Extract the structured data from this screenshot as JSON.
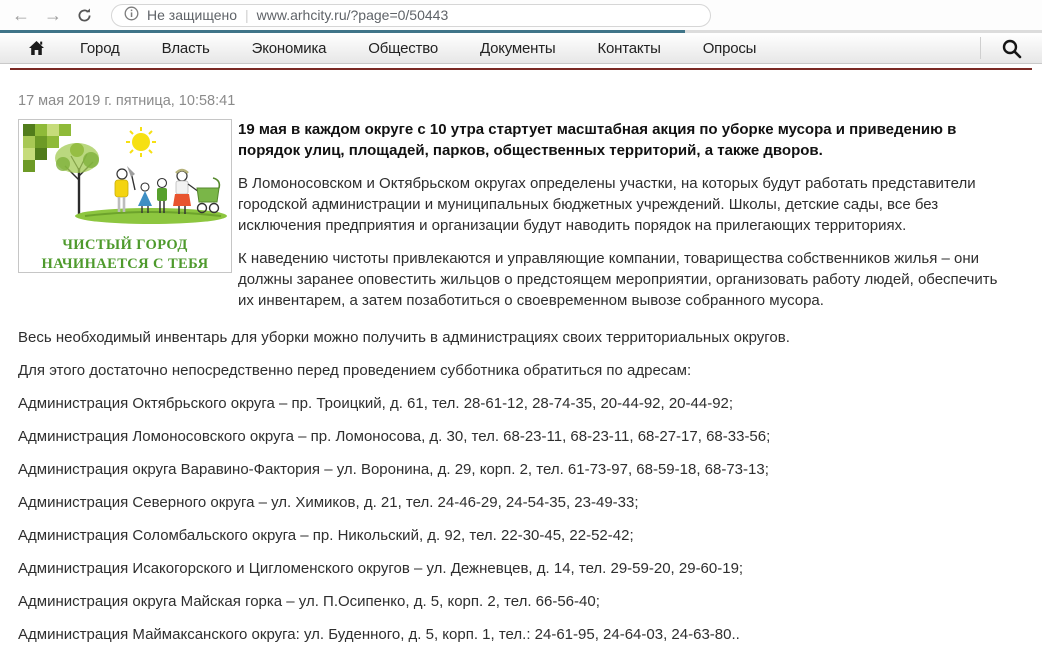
{
  "browser": {
    "back_label": "←",
    "forward_label": "→",
    "security_label": "Не защищено",
    "url": "www.arhcity.ru/?page=0/50443"
  },
  "nav": {
    "items": [
      "Город",
      "Власть",
      "Экономика",
      "Общество",
      "Документы",
      "Контакты",
      "Опросы"
    ]
  },
  "page": {
    "datetime": "17 мая 2019 г. пятница, 10:58:41"
  },
  "article": {
    "poster": {
      "line1": "ЧИСТЫЙ ГОРОД",
      "line2": "НАЧИНАЕТСЯ С ТЕБЯ"
    },
    "lead": "19 мая в каждом округе с 10 утра стартует масштабная акция по уборке мусора и приведению в порядок улиц, площадей, парков, общественных территорий, а также дворов.",
    "side_paragraphs": [
      "В Ломоносовском и Октябрьском округах определены участки, на которых будут работать представители городской администрации и муниципальных бюджетных учреждений. Школы, детские сады, все без исключения предприятия и организации будут наводить порядок на прилегающих территориях.",
      "К наведению чистоты привлекаются и управляющие компании, товарищества собственников жилья – они должны заранее оповестить жильцов о предстоящем мероприятии, организовать работу людей, обеспечить их инвентарем, а затем позаботиться о своевременном вывозе собранного мусора."
    ],
    "full_paragraphs": [
      "Весь необходимый инвентарь для уборки можно получить в администрациях своих территориальных округов.",
      "Для этого достаточно непосредственно перед проведением субботника обратиться по адресам:"
    ],
    "addresses": [
      "Администрация Октябрьского округа – пр. Троицкий, д. 61, тел. 28-61-12, 28-74-35, 20-44-92, 20-44-92;",
      "Администрация Ломоносовского округа – пр. Ломоносова, д. 30, тел. 68-23-11, 68-23-11, 68-27-17, 68-33-56;",
      "Администрация округа Варавино-Фактория – ул. Воронина, д. 29, корп. 2, тел. 61-73-97, 68-59-18, 68-73-13;",
      "Администрация Северного округа – ул. Химиков, д. 21, тел. 24-46-29, 24-54-35, 23-49-33;",
      "Администрация Соломбальского округа – пр. Никольский, д. 92, тел. 22-30-45, 22-52-42;",
      "Администрация Исакогорского и Цигломенского округов – ул. Дежневцев, д. 14, тел. 29-59-20, 29-60-19;",
      "Администрация округа Майская горка – ул. П.Осипенко, д. 5, корп. 2, тел. 66-56-40;",
      "Администрация Маймаксанского округа: ул. Буденного, д. 5, корп. 1, тел.: 24-61-95, 24-64-03, 24-63-80.."
    ]
  },
  "colors": {
    "maroon_rule": "#7b2a25",
    "progress_teal": "#3f7488",
    "poster_green": "#4e9a2c"
  }
}
